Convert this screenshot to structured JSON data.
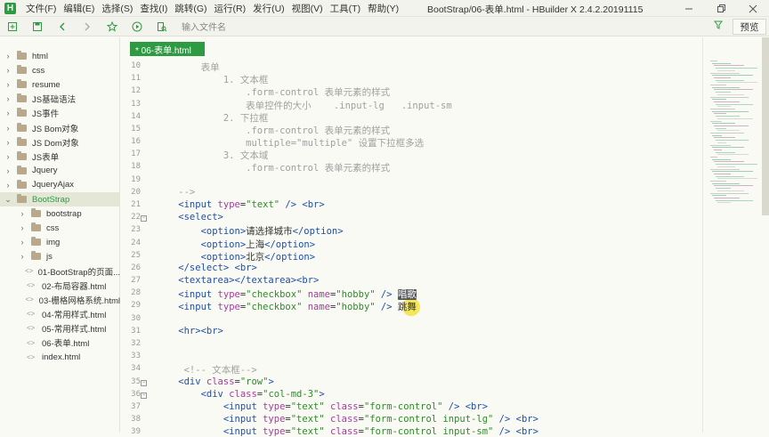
{
  "menubar": {
    "logo": "H",
    "items": [
      "文件(F)",
      "编辑(E)",
      "选择(S)",
      "查找(I)",
      "跳转(G)",
      "运行(R)",
      "发行(U)",
      "视图(V)",
      "工具(T)",
      "帮助(Y)"
    ],
    "title": "BootStrap/06-表单.html - HBuilder X 2.4.2.20191115"
  },
  "toolbar": {
    "path_placeholder": "输入文件名",
    "preview_label": "预览"
  },
  "sidebar": {
    "items": [
      {
        "label": "html",
        "type": "folder",
        "expanded": false
      },
      {
        "label": "css",
        "type": "folder",
        "expanded": false
      },
      {
        "label": "resume",
        "type": "folder",
        "expanded": false
      },
      {
        "label": "JS基础语法",
        "type": "folder",
        "expanded": false
      },
      {
        "label": "JS事件",
        "type": "folder",
        "expanded": false
      },
      {
        "label": "JS Bom对象",
        "type": "folder",
        "expanded": false
      },
      {
        "label": "JS Dom对象",
        "type": "folder",
        "expanded": false
      },
      {
        "label": "JS表单",
        "type": "folder",
        "expanded": false
      },
      {
        "label": "Jquery",
        "type": "folder",
        "expanded": false
      },
      {
        "label": "JqueryAjax",
        "type": "folder",
        "expanded": false
      },
      {
        "label": "BootStrap",
        "type": "folder",
        "expanded": true
      },
      {
        "label": "bootstrap",
        "type": "folder",
        "expanded": false
      },
      {
        "label": "css",
        "type": "folder",
        "expanded": false
      },
      {
        "label": "img",
        "type": "folder",
        "expanded": false
      },
      {
        "label": "js",
        "type": "folder",
        "expanded": false
      },
      {
        "label": "01-BootStrap的页面...",
        "type": "file"
      },
      {
        "label": "02-布局容器.html",
        "type": "file"
      },
      {
        "label": "03-栅格网格系统.html",
        "type": "file"
      },
      {
        "label": "04-常用样式.html",
        "type": "file"
      },
      {
        "label": "05-常用样式.html",
        "type": "file"
      },
      {
        "label": "06-表单.html",
        "type": "file"
      },
      {
        "label": "index.html",
        "type": "file"
      }
    ]
  },
  "editor": {
    "tab_label": "* 06-表单.html",
    "lines": [
      {
        "n": "10",
        "parts": [
          [
            "c",
            "        表单"
          ]
        ]
      },
      {
        "n": "11",
        "parts": [
          [
            "c",
            "            1. 文本框"
          ]
        ]
      },
      {
        "n": "12",
        "parts": [
          [
            "c",
            "                .form-control 表单元素的样式"
          ]
        ]
      },
      {
        "n": "13",
        "parts": [
          [
            "c",
            "                表单控件的大小    .input-lg   .input-sm"
          ]
        ]
      },
      {
        "n": "14",
        "parts": [
          [
            "c",
            "            2. 下拉框"
          ]
        ]
      },
      {
        "n": "15",
        "parts": [
          [
            "c",
            "                .form-control 表单元素的样式"
          ]
        ]
      },
      {
        "n": "16",
        "parts": [
          [
            "c",
            "                multiple=\"multiple\" 设置下拉框多选"
          ]
        ]
      },
      {
        "n": "17",
        "parts": [
          [
            "c",
            "            3. 文本域"
          ]
        ]
      },
      {
        "n": "18",
        "parts": [
          [
            "c",
            "                .form-control 表单元素的样式"
          ]
        ]
      },
      {
        "n": "19",
        "parts": []
      },
      {
        "n": "20",
        "parts": [
          [
            "c",
            "    -->"
          ]
        ]
      },
      {
        "n": "21",
        "parts": [
          [
            "g",
            "    <input "
          ],
          [
            "a",
            "type"
          ],
          [
            "x",
            "="
          ],
          [
            "s",
            "\"text\""
          ],
          [
            "g",
            " /> <br>"
          ]
        ]
      },
      {
        "n": "22",
        "parts": [
          [
            "g",
            "    <select>"
          ]
        ]
      },
      {
        "n": "23",
        "parts": [
          [
            "g",
            "        <option>"
          ],
          [
            "x",
            "请选择城市"
          ],
          [
            "g",
            "</option>"
          ]
        ]
      },
      {
        "n": "24",
        "parts": [
          [
            "g",
            "        <option>"
          ],
          [
            "x",
            "上海"
          ],
          [
            "g",
            "</option>"
          ]
        ]
      },
      {
        "n": "25",
        "parts": [
          [
            "g",
            "        <option>"
          ],
          [
            "x",
            "北京"
          ],
          [
            "g",
            "</option>"
          ]
        ]
      },
      {
        "n": "26",
        "parts": [
          [
            "g",
            "    </select> <br>"
          ]
        ]
      },
      {
        "n": "27",
        "parts": [
          [
            "g",
            "    <textarea></textarea><br>"
          ]
        ]
      },
      {
        "n": "28",
        "parts": [
          [
            "g",
            "    <input "
          ],
          [
            "a",
            "type"
          ],
          [
            "x",
            "="
          ],
          [
            "s",
            "\"checkbox\""
          ],
          [
            "x",
            " "
          ],
          [
            "a",
            "name"
          ],
          [
            "x",
            "="
          ],
          [
            "s",
            "\"hobby\""
          ],
          [
            "g",
            " /> "
          ],
          [
            "h",
            "唱歌"
          ]
        ]
      },
      {
        "n": "29",
        "parts": [
          [
            "g",
            "    <input "
          ],
          [
            "a",
            "type"
          ],
          [
            "x",
            "="
          ],
          [
            "s",
            "\"checkbox\""
          ],
          [
            "x",
            " "
          ],
          [
            "a",
            "name"
          ],
          [
            "x",
            "="
          ],
          [
            "s",
            "\"hobby\""
          ],
          [
            "g",
            " /> "
          ],
          [
            "x",
            "跳舞"
          ]
        ]
      },
      {
        "n": "30",
        "parts": []
      },
      {
        "n": "31",
        "parts": [
          [
            "g",
            "    <hr><br>"
          ]
        ]
      },
      {
        "n": "32",
        "parts": []
      },
      {
        "n": "33",
        "parts": []
      },
      {
        "n": "34",
        "parts": [
          [
            "c",
            "     <!-- 文本框-->"
          ]
        ]
      },
      {
        "n": "35",
        "parts": [
          [
            "g",
            "    <div "
          ],
          [
            "a",
            "class"
          ],
          [
            "x",
            "="
          ],
          [
            "s",
            "\"row\""
          ],
          [
            "g",
            ">"
          ]
        ]
      },
      {
        "n": "36",
        "parts": [
          [
            "g",
            "        <div "
          ],
          [
            "a",
            "class"
          ],
          [
            "x",
            "="
          ],
          [
            "s",
            "\"col-md-3\""
          ],
          [
            "g",
            ">"
          ]
        ]
      },
      {
        "n": "37",
        "parts": [
          [
            "g",
            "            <input "
          ],
          [
            "a",
            "type"
          ],
          [
            "x",
            "="
          ],
          [
            "s",
            "\"text\""
          ],
          [
            "x",
            " "
          ],
          [
            "a",
            "class"
          ],
          [
            "x",
            "="
          ],
          [
            "s",
            "\"form-control\""
          ],
          [
            "g",
            " /> <br>"
          ]
        ]
      },
      {
        "n": "38",
        "parts": [
          [
            "g",
            "            <input "
          ],
          [
            "a",
            "type"
          ],
          [
            "x",
            "="
          ],
          [
            "s",
            "\"text\""
          ],
          [
            "x",
            " "
          ],
          [
            "a",
            "class"
          ],
          [
            "x",
            "="
          ],
          [
            "s",
            "\"form-control input-lg\""
          ],
          [
            "g",
            " /> <br>"
          ]
        ]
      },
      {
        "n": "39",
        "parts": [
          [
            "g",
            "            <input "
          ],
          [
            "a",
            "type"
          ],
          [
            "x",
            "="
          ],
          [
            "s",
            "\"text\""
          ],
          [
            "x",
            " "
          ],
          [
            "a",
            "class"
          ],
          [
            "x",
            "="
          ],
          [
            "s",
            "\"form-control input-sm\""
          ],
          [
            "g",
            " /> <br>"
          ]
        ]
      }
    ]
  }
}
